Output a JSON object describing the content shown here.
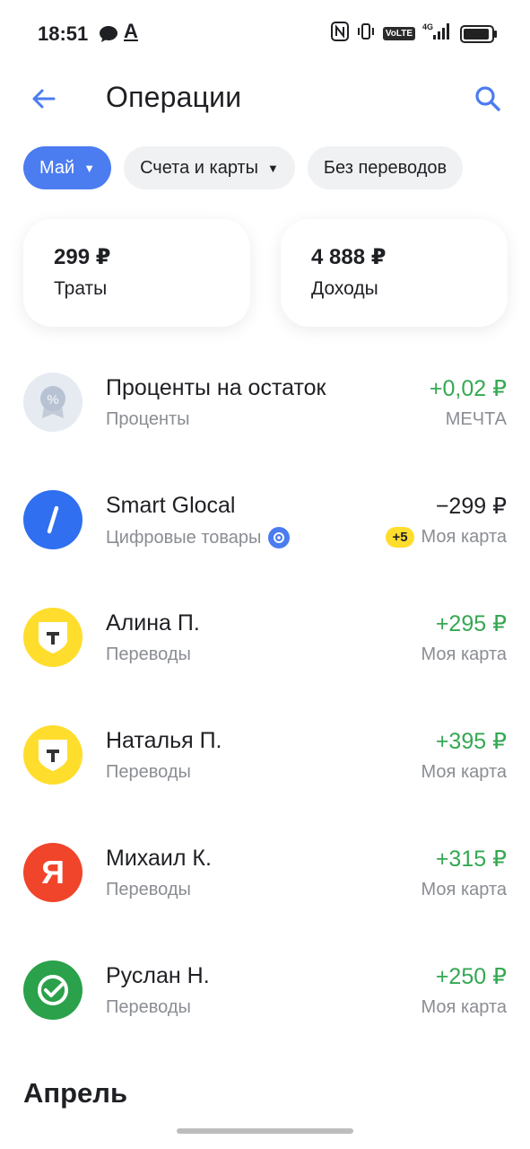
{
  "status_bar": {
    "time": "18:51",
    "alpha": "A",
    "volte": "VoLTE",
    "network": "4G"
  },
  "header": {
    "title": "Операции"
  },
  "filters": [
    {
      "label": "Май",
      "active": true,
      "caret": "▼"
    },
    {
      "label": "Счета и карты",
      "active": false,
      "caret": "▼"
    },
    {
      "label": "Без переводов",
      "active": false
    }
  ],
  "summary": {
    "spending": {
      "amount": "299 ₽",
      "label": "Траты"
    },
    "income": {
      "amount": "4 888 ₽",
      "label": "Доходы"
    }
  },
  "operations": [
    {
      "name": "Проценты на остаток",
      "category": "Проценты",
      "amount": "+0,02 ₽",
      "source": "МЕЧТА",
      "icon": "percent-badge-icon"
    },
    {
      "name": "Smart Glocal",
      "category": "Цифровые товары",
      "amount": "−299 ₽",
      "source": "Моя карта",
      "bonus": "+5",
      "icon": "slash-logo-icon"
    },
    {
      "name": "Алина П.",
      "category": "Переводы",
      "amount": "+295 ₽",
      "source": "Моя карта",
      "icon": "tbank-logo-icon"
    },
    {
      "name": "Наталья П.",
      "category": "Переводы",
      "amount": "+395 ₽",
      "source": "Моя карта",
      "icon": "tbank-logo-icon"
    },
    {
      "name": "Михаил К.",
      "category": "Переводы",
      "amount": "+315 ₽",
      "source": "Моя карта",
      "icon": "yandex-logo-icon",
      "logo_letter": "Я"
    },
    {
      "name": "Руслан Н.",
      "category": "Переводы",
      "amount": "+250 ₽",
      "source": "Моя карта",
      "icon": "sber-logo-icon"
    }
  ],
  "next_month": "Апрель",
  "colors": {
    "accent": "#4b7cf0",
    "positive": "#35a852",
    "muted": "#8a8d93",
    "tbank_yellow": "#ffdd2d",
    "yandex_red": "#fc3f1d",
    "sber_green": "#21a038"
  }
}
